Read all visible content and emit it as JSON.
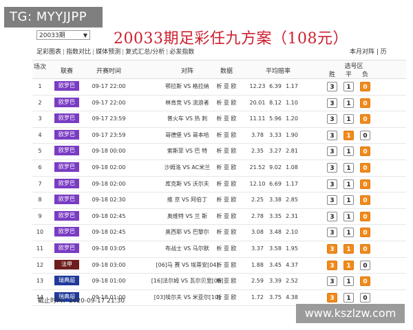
{
  "overlay": {
    "tg_label": "TG: MYYJJPP",
    "watermark": "www.kszlzw.com"
  },
  "period": {
    "selected": "20033期"
  },
  "title": "20033期足彩任九方案（108元）",
  "nav": {
    "items": [
      "足彩图表",
      "指数对比",
      "媒体预测",
      "复式汇总/分析",
      "必发指数"
    ],
    "right": "本月对阵 | 历"
  },
  "table": {
    "headers": {
      "num": "场次",
      "league": "联赛",
      "time": "开赛时间",
      "match": "对阵",
      "data": "数据",
      "odds": "平均赔率",
      "pick_zone": "选号区",
      "win": "胜",
      "draw": "平",
      "lose": "负"
    },
    "colors": {
      "euro": "#7a3cc3",
      "ligue1": "#6e1d1d",
      "sweden": "#1f3a9a",
      "pick_on": "#f08a1c"
    },
    "rows": [
      {
        "n": "1",
        "league": "欧罗巴",
        "lc": "euro",
        "time": "09-17 22:00",
        "match": "鄂拉斯 VS 格拉纳",
        "links": "析 亚 欧",
        "o1": "12.23",
        "o2": "6.39",
        "o3": "1.17",
        "p": [
          "3",
          "1",
          "0"
        ],
        "on": [
          false,
          false,
          true
        ]
      },
      {
        "n": "2",
        "league": "欧罗巴",
        "lc": "euro",
        "time": "09-17 22:00",
        "match": "林肯竞 VS 流浪者",
        "links": "析 亚 欧",
        "o1": "20.01",
        "o2": "8.12",
        "o3": "1.10",
        "p": [
          "3",
          "1",
          "0"
        ],
        "on": [
          false,
          false,
          true
        ]
      },
      {
        "n": "3",
        "league": "欧罗巴",
        "lc": "euro",
        "time": "09-17 23:59",
        "match": "普火车 VS 热 刺",
        "links": "析 亚 欧",
        "o1": "11.11",
        "o2": "5.96",
        "o3": "1.20",
        "p": [
          "3",
          "1",
          "0"
        ],
        "on": [
          false,
          false,
          true
        ]
      },
      {
        "n": "4",
        "league": "欧罗巴",
        "lc": "euro",
        "time": "09-17 23:59",
        "match": "哥德堡 VS 哥本哈",
        "links": "析 亚 欧",
        "o1": "3.78",
        "o2": "3.33",
        "o3": "1.90",
        "p": [
          "3",
          "1",
          "0"
        ],
        "on": [
          false,
          true,
          false
        ]
      },
      {
        "n": "5",
        "league": "欧罗巴",
        "lc": "euro",
        "time": "09-18 00:00",
        "match": "索斯菲 VS 巴 特",
        "links": "析 亚 欧",
        "o1": "2.35",
        "o2": "3.27",
        "o3": "2.81",
        "p": [
          "3",
          "1",
          "0"
        ],
        "on": [
          false,
          false,
          true
        ]
      },
      {
        "n": "6",
        "league": "欧罗巴",
        "lc": "euro",
        "time": "09-18 02:00",
        "match": "沙姆洛 VS AC米兰",
        "links": "析 亚 欧",
        "o1": "21.52",
        "o2": "9.02",
        "o3": "1.08",
        "p": [
          "3",
          "1",
          "0"
        ],
        "on": [
          false,
          false,
          true
        ]
      },
      {
        "n": "7",
        "league": "欧罗巴",
        "lc": "euro",
        "time": "09-18 02:00",
        "match": "库克斯 VS 沃尔夫",
        "links": "析 亚 欧",
        "o1": "12.10",
        "o2": "6.69",
        "o3": "1.17",
        "p": [
          "3",
          "1",
          "0"
        ],
        "on": [
          false,
          false,
          true
        ]
      },
      {
        "n": "8",
        "league": "欧罗巴",
        "lc": "euro",
        "time": "09-18 02:30",
        "match": "维 京 VS 阿伯丁",
        "links": "析 亚 欧",
        "o1": "2.25",
        "o2": "3.38",
        "o3": "2.85",
        "p": [
          "3",
          "1",
          "0"
        ],
        "on": [
          false,
          false,
          true
        ]
      },
      {
        "n": "9",
        "league": "欧罗巴",
        "lc": "euro",
        "time": "09-18 02:45",
        "match": "奥维特 VS 兰 斯",
        "links": "析 亚 欧",
        "o1": "2.78",
        "o2": "3.35",
        "o3": "2.31",
        "p": [
          "3",
          "1",
          "0"
        ],
        "on": [
          false,
          false,
          true
        ]
      },
      {
        "n": "10",
        "league": "欧罗巴",
        "lc": "euro",
        "time": "09-18 02:45",
        "match": "奥西耶 VS 巴黎尔",
        "links": "析 亚 欧",
        "o1": "3.08",
        "o2": "3.48",
        "o3": "2.10",
        "p": [
          "3",
          "1",
          "0"
        ],
        "on": [
          false,
          false,
          true
        ]
      },
      {
        "n": "11",
        "league": "欧罗巴",
        "lc": "euro",
        "time": "09-18 03:05",
        "match": "布战士 VS 马尔默",
        "links": "析 亚 欧",
        "o1": "3.37",
        "o2": "3.58",
        "o3": "1.95",
        "p": [
          "3",
          "1",
          "0"
        ],
        "on": [
          true,
          true,
          true
        ]
      },
      {
        "n": "12",
        "league": "法甲",
        "lc": "ligue1",
        "time": "09-18 03:00",
        "match": "[06]马 赛 VS 埃蒂安[04]",
        "links": "析 亚 欧",
        "o1": "1.88",
        "o2": "3.45",
        "o3": "4.37",
        "p": [
          "3",
          "1",
          "0"
        ],
        "on": [
          true,
          true,
          false
        ]
      },
      {
        "n": "13",
        "league": "瑞典超",
        "lc": "sweden",
        "time": "09-18 01:00",
        "match": "[16]法尔姆 VS 瓦尔贝里[08]",
        "links": "析 亚 欧",
        "o1": "2.59",
        "o2": "3.39",
        "o3": "2.52",
        "p": [
          "3",
          "1",
          "0"
        ],
        "on": [
          false,
          false,
          true
        ]
      },
      {
        "n": "14",
        "league": "瑞典超",
        "lc": "sweden",
        "time": "09-18 01:00",
        "match": "[03]埃尔夫 VS 米亚尔[10]",
        "links": "析 亚 欧",
        "o1": "1.72",
        "o2": "3.75",
        "o3": "4.38",
        "p": [
          "3",
          "1",
          "0"
        ],
        "on": [
          true,
          false,
          false
        ]
      }
    ]
  },
  "footer": {
    "deadline": "截止时间：2020-09-17 21:30"
  }
}
